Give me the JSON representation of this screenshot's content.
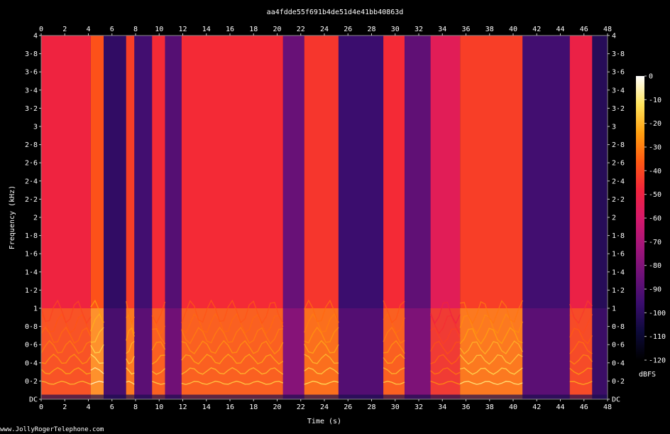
{
  "chart_data": {
    "type": "heatmap",
    "title": "aa4fdde55f691b4de51d4e41bb40863d",
    "xlabel": "Time (s)",
    "ylabel": "Frequency (kHz)",
    "xlim": [
      0,
      48
    ],
    "ylim": [
      0,
      4
    ],
    "x_ticks": [
      "0",
      "2",
      "4",
      "6",
      "8",
      "10",
      "12",
      "14",
      "16",
      "18",
      "20",
      "22",
      "24",
      "26",
      "28",
      "30",
      "32",
      "34",
      "36",
      "38",
      "40",
      "42",
      "44",
      "46",
      "48"
    ],
    "y_ticks": [
      "DC",
      "0·2",
      "0·4",
      "0·6",
      "0·8",
      "1",
      "1·2",
      "1·4",
      "1·6",
      "1·8",
      "2",
      "2·2",
      "2·4",
      "2·6",
      "2·8",
      "3",
      "3·2",
      "3·4",
      "3·6",
      "3·8",
      "4"
    ],
    "colorbar": {
      "label": "dBFS",
      "range": [
        -120,
        0
      ],
      "ticks": [
        "0",
        "-10",
        "-20",
        "-30",
        "-40",
        "-50",
        "-60",
        "-70",
        "-80",
        "-90",
        "-100",
        "-110",
        "-120"
      ],
      "colors": [
        "#000000",
        "#0d0a3a",
        "#3a0d6e",
        "#6e1178",
        "#a3157a",
        "#d6186a",
        "#f2243b",
        "#ff5a12",
        "#ffa010",
        "#ffe45c",
        "#ffffff"
      ]
    },
    "segments": [
      {
        "start": 0.0,
        "end": 4.2,
        "level": 0.82
      },
      {
        "start": 4.2,
        "end": 5.3,
        "level": 0.95
      },
      {
        "start": 5.3,
        "end": 7.2,
        "level": 0.25
      },
      {
        "start": 7.2,
        "end": 7.9,
        "level": 0.9
      },
      {
        "start": 7.9,
        "end": 9.4,
        "level": 0.3
      },
      {
        "start": 9.4,
        "end": 10.5,
        "level": 0.85
      },
      {
        "start": 10.5,
        "end": 11.9,
        "level": 0.35
      },
      {
        "start": 11.9,
        "end": 20.5,
        "level": 0.85
      },
      {
        "start": 20.5,
        "end": 22.3,
        "level": 0.4
      },
      {
        "start": 22.3,
        "end": 25.2,
        "level": 0.88
      },
      {
        "start": 25.2,
        "end": 29.0,
        "level": 0.28
      },
      {
        "start": 29.0,
        "end": 30.8,
        "level": 0.85
      },
      {
        "start": 30.8,
        "end": 33.0,
        "level": 0.38
      },
      {
        "start": 33.0,
        "end": 35.5,
        "level": 0.75
      },
      {
        "start": 35.5,
        "end": 40.8,
        "level": 0.9
      },
      {
        "start": 40.8,
        "end": 44.8,
        "level": 0.3
      },
      {
        "start": 44.8,
        "end": 46.7,
        "level": 0.8
      },
      {
        "start": 46.7,
        "end": 48.0,
        "level": 0.22
      }
    ]
  },
  "footer": {
    "credit": "www.JollyRogerTelephone.com"
  }
}
